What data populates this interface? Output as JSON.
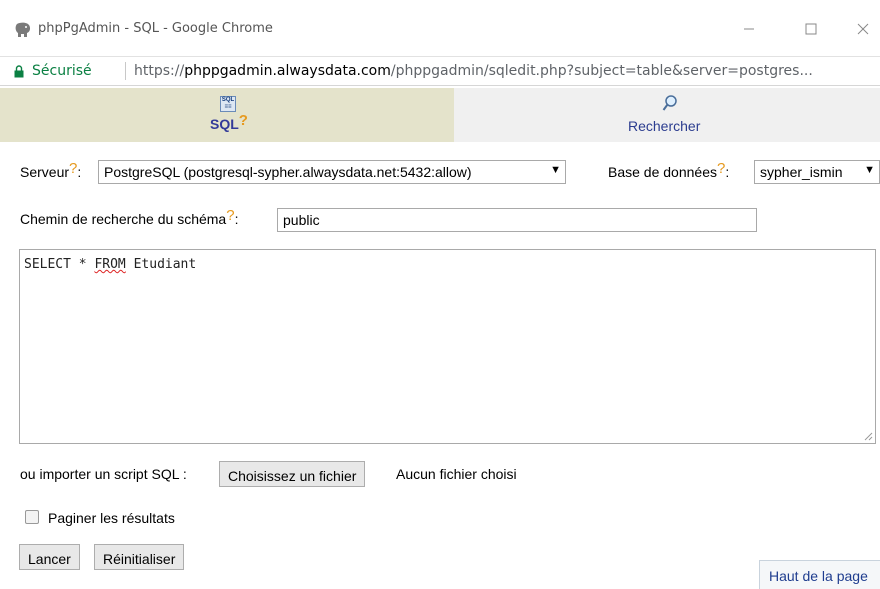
{
  "window": {
    "title": "phpPgAdmin - SQL - Google Chrome",
    "minimize_icon": "minimize-icon",
    "maximize_icon": "maximize-icon",
    "close_icon": "close-icon"
  },
  "addressbar": {
    "secure_label": "Sécurisé",
    "url_scheme": "https://",
    "url_domain": "phppgadmin.alwaysdata.com",
    "url_path": "/phppgadmin/sqledit.php?subject=table&server=postgres..."
  },
  "tabs": {
    "sql_label": "SQL",
    "sql_help": "?",
    "search_label": "Rechercher"
  },
  "form": {
    "server_label": "Serveur",
    "server_help": "?",
    "server_value": "PostgreSQL (postgresql-sypher.alwaysdata.net:5432:allow)",
    "database_label": "Base de données",
    "database_help": "?",
    "database_value": "sypher_ismin",
    "schema_label": "Chemin de recherche du schéma",
    "schema_help": "?",
    "schema_value": "public",
    "colon": ":",
    "sql_keyword_1": "SELECT * ",
    "sql_keyword_2": "FROM",
    "sql_rest": " Etudiant",
    "import_label": "ou importer un script SQL :",
    "file_button": "Choisissez un fichier",
    "file_status": "Aucun fichier choisi",
    "paginate_label": "Paginer les résultats",
    "paginate_checked": false,
    "run_button": "Lancer",
    "reset_button": "Réinitialiser",
    "top_link": "Haut de la page"
  },
  "colors": {
    "secure_green": "#0b8043",
    "tab_active_bg": "#e4e3cb",
    "help_orange": "#e69a1f",
    "link_blue": "#2b3c8f"
  }
}
